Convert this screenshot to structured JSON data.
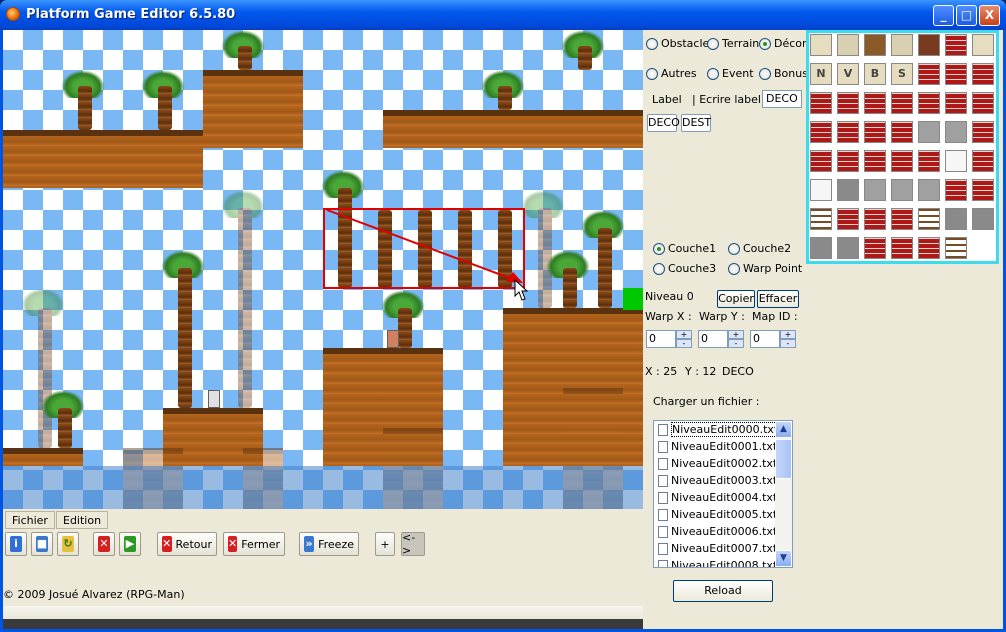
{
  "window": {
    "title": "Platform Game Editor 6.5.80",
    "minimize": "_",
    "maximize": "□",
    "close": "X"
  },
  "menu": {
    "file": "Fichier",
    "edit": "Edition"
  },
  "toolbar": {
    "retour": "Retour",
    "fermer": "Fermer",
    "freeze": "Freeze",
    "plus": "+",
    "swap": "<->"
  },
  "footer": {
    "copyright": "© 2009 Josué Alvarez (RPG-Man)"
  },
  "panel": {
    "categories": {
      "obstacle": "Obstacle",
      "terrain": "Terrain",
      "decor": "Décor",
      "autres": "Autres",
      "event": "Event",
      "bonus": "Bonus"
    },
    "label_caption": "Label",
    "write_label_caption": "| Ecrire label :",
    "label_value": "DECO",
    "tag_deco": "DECO",
    "tag_dest": "DEST",
    "layers": {
      "couche1": "Couche1",
      "couche2": "Couche2",
      "couche3": "Couche3",
      "warp_point": "Warp Point"
    },
    "niveau": "Niveau 0",
    "copier": "Copier",
    "effacer": "Effacer",
    "warp_x_label": "Warp X :",
    "warp_y_label": "Warp Y :",
    "map_id_label": "Map ID :",
    "warp_x": "0",
    "warp_y": "0",
    "map_id": "0",
    "coord_x": "X : 25",
    "coord_y": "Y : 12",
    "coord_tag": "DECO",
    "charger": "Charger un fichier :",
    "files": [
      "NiveauEdit0000.txt",
      "NiveauEdit0001.txt",
      "NiveauEdit0002.txt",
      "NiveauEdit0003.txt",
      "NiveauEdit0004.txt",
      "NiveauEdit0005.txt",
      "NiveauEdit0006.txt",
      "NiveauEdit0007.txt",
      "NiveauEdit0008.txt"
    ],
    "reload": "Reload"
  },
  "palette": {
    "letters": [
      "N",
      "V",
      "B",
      "S"
    ]
  },
  "colors": {
    "selection": "#e00000",
    "palette_border": "#3cdcf0",
    "sky_check": "#7ab8f5"
  }
}
